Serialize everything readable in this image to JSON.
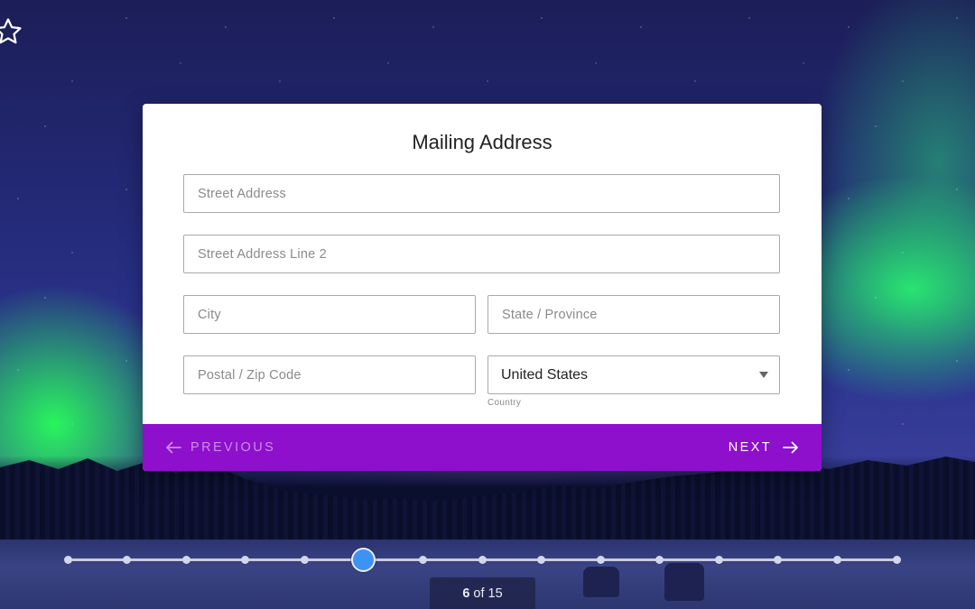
{
  "form": {
    "title": "Mailing Address",
    "street": {
      "placeholder": "Street Address",
      "value": ""
    },
    "street2": {
      "placeholder": "Street Address Line 2",
      "value": ""
    },
    "city": {
      "placeholder": "City",
      "value": ""
    },
    "state": {
      "placeholder": "State / Province",
      "value": ""
    },
    "postal": {
      "placeholder": "Postal / Zip Code",
      "value": ""
    },
    "country": {
      "selected": "United States",
      "caption": "Country"
    }
  },
  "navigation": {
    "previous_label": "PREVIOUS",
    "next_label": "NEXT",
    "bar_color": "#8e0fcc"
  },
  "progress": {
    "current": "6",
    "separator": "of",
    "total": "15",
    "step_count": 15,
    "current_index": 6,
    "handle_color": "#3d93f4"
  },
  "icons": {
    "favorite": "star-outline-icon",
    "previous": "arrow-left-icon",
    "next": "arrow-right-icon",
    "dropdown": "chevron-down-icon"
  }
}
